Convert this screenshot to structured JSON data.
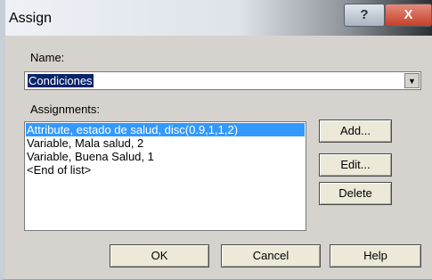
{
  "window": {
    "title": "Assign"
  },
  "name_section": {
    "label": "Name:",
    "value": "Condiciones"
  },
  "assignments": {
    "label": "Assignments:",
    "items": [
      "Attribute, estado de salud, disc(0.9,1,1,2)",
      "Variable, Mala salud, 2",
      "Variable, Buena Salud, 1",
      "<End of list>"
    ]
  },
  "buttons": {
    "add": "Add...",
    "edit": "Edit...",
    "delete": "Delete",
    "ok": "OK",
    "cancel": "Cancel",
    "help": "Help"
  },
  "titlebar": {
    "help": "?",
    "close": "X"
  },
  "icons": {
    "dropdown": "chevron-down-icon",
    "close": "close-icon",
    "help": "question-icon"
  }
}
